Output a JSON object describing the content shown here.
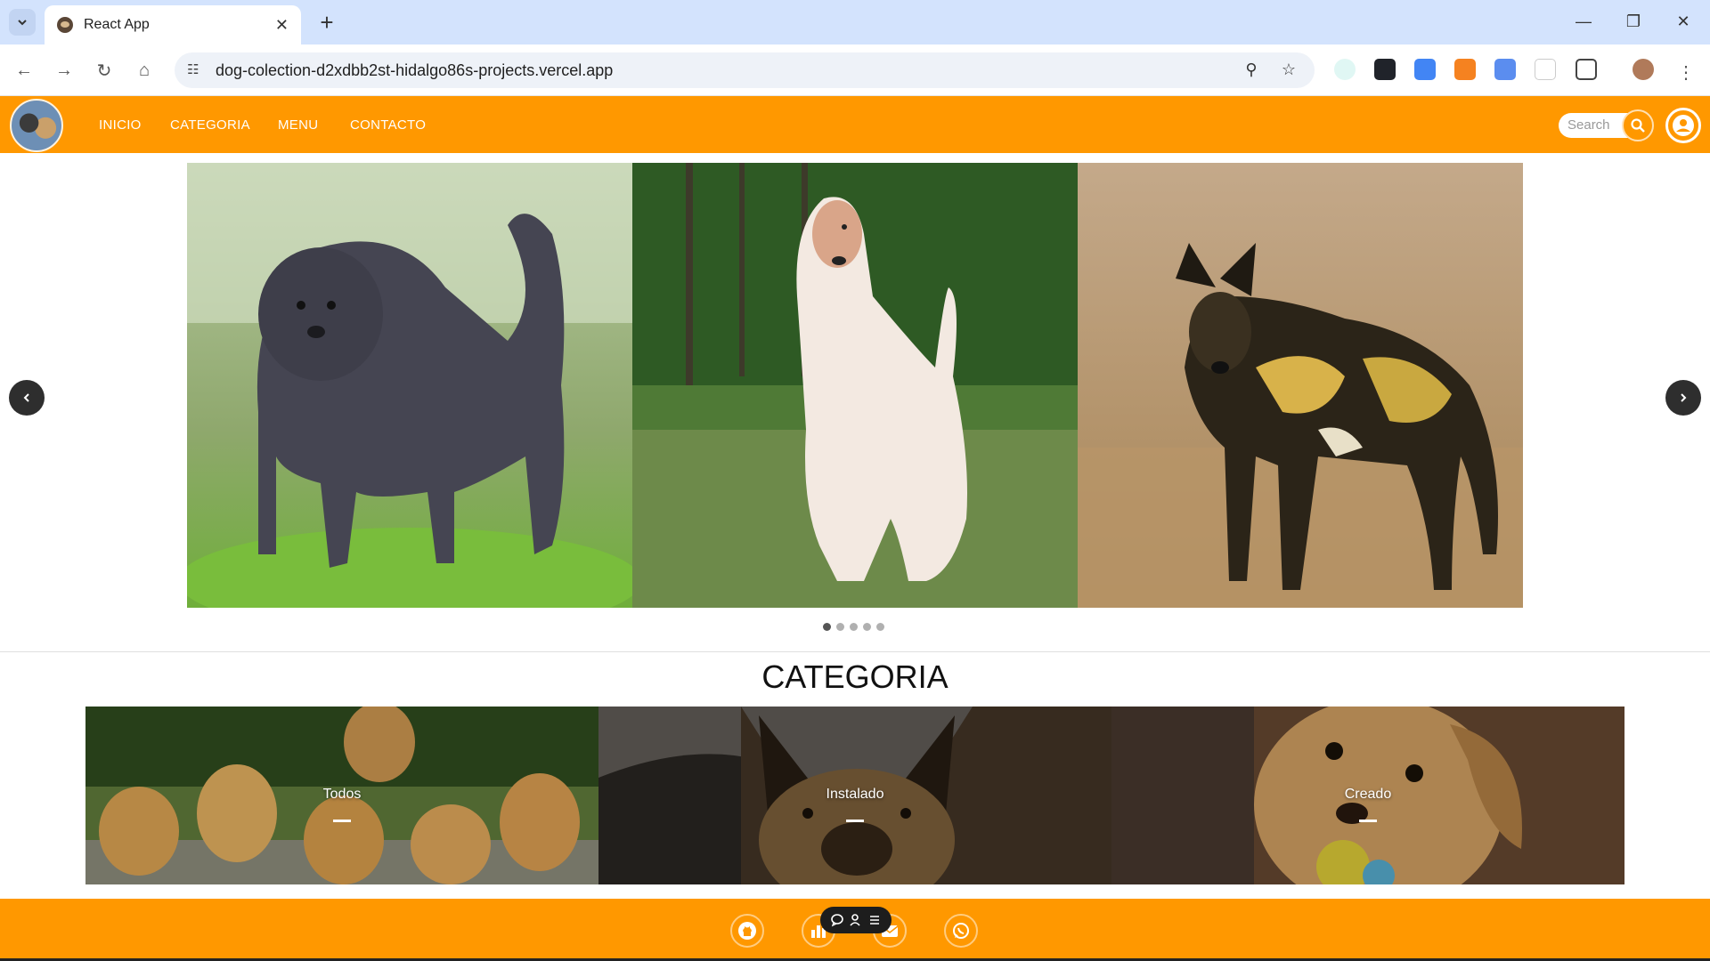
{
  "browser": {
    "tab_title": "React App",
    "new_tab": "+",
    "url": "dog-colection-d2xdbb2st-hidalgo86s-projects.vercel.app"
  },
  "nav": {
    "links": [
      "INICIO",
      "CATEGORIA",
      "MENU",
      "CONTACTO"
    ],
    "search_placeholder": "Search"
  },
  "carousel": {
    "slides": [
      "affenpinscher",
      "afghan-hound",
      "african-wild-dog"
    ],
    "slide_count": 5,
    "active_index": 0
  },
  "categories": {
    "title": "CATEGORIA",
    "items": [
      "Todos",
      "Instalado",
      "Creado"
    ]
  },
  "footer": {
    "buttons": [
      "github-icon",
      "chart-icon",
      "mail-icon",
      "whatsapp-icon"
    ]
  },
  "colors": {
    "primary": "#ff9800",
    "tabstrip": "#d3e3fd"
  }
}
